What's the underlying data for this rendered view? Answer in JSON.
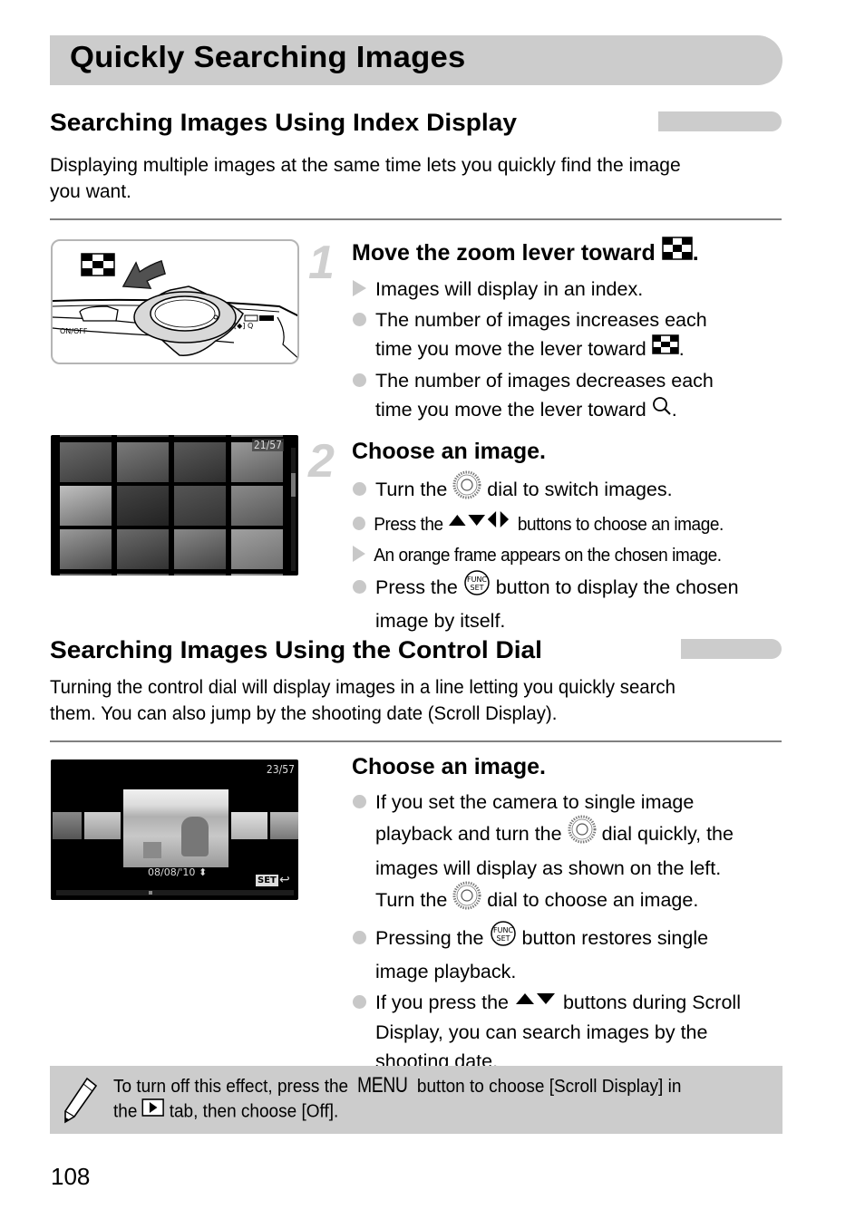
{
  "page": {
    "title": "Quickly Searching Images",
    "page_number": "108"
  },
  "section1": {
    "heading": "Searching Images Using Index Display",
    "intro_lines": [
      "Displaying multiple images at the same time lets you quickly find the image",
      "you want."
    ],
    "figure1": {
      "label": "ON/OFF",
      "icon": "index-checker-icon"
    },
    "step1": {
      "number": "1",
      "title": "Move the zoom lever toward",
      "title_icon": "index-checker-icon",
      "title_end": ".",
      "bullets": [
        {
          "type": "result",
          "lines": [
            "Images will display in an index."
          ]
        },
        {
          "type": "info",
          "lines": [
            "The number of images increases each",
            "time you move the lever toward"
          ],
          "icon": "index-checker-icon",
          "end": "."
        },
        {
          "type": "info",
          "lines": [
            "The number of images decreases each",
            "time you move the lever toward"
          ],
          "icon": "magnifier-icon",
          "end": "."
        }
      ]
    },
    "figure2": {
      "counter": "21/57"
    },
    "step2": {
      "number": "2",
      "title": "Choose an image.",
      "bullets": [
        {
          "type": "info",
          "before": "Turn the",
          "icon": "control-dial-icon",
          "after": "dial to switch images."
        },
        {
          "type": "info",
          "before": "Press the",
          "icon": "arrow-buttons-icon",
          "after": "buttons to choose an image."
        },
        {
          "type": "result",
          "text": "An orange frame appears on the chosen image."
        },
        {
          "type": "info",
          "before": "Press the",
          "icon": "func-set-icon",
          "after": "button to display the chosen",
          "line2": "image by itself."
        }
      ]
    }
  },
  "section2": {
    "heading": "Searching Images Using the Control Dial",
    "intro_lines": [
      "Turning the control dial will display images in a line letting you quickly search",
      "them. You can also jump by the shooting date (Scroll Display)."
    ],
    "figure3": {
      "counter": "23/57",
      "date": "08/08/'10",
      "set_label": "SET"
    },
    "step": {
      "title": "Choose an image.",
      "bullets": [
        {
          "lines": [
            "If you set the camera to single image",
            "playback and turn the",
            "dial quickly, the",
            "images will display as shown on the left.",
            "Turn the",
            "dial to choose an image."
          ]
        },
        {
          "lines": [
            "Pressing the",
            "button restores single",
            "image playback."
          ]
        },
        {
          "lines": [
            "If you press the",
            "buttons during Scroll",
            "Display, you can search images by the",
            "shooting date."
          ]
        }
      ]
    }
  },
  "note": {
    "icon": "pencil-icon",
    "part1": "To turn off this effect, press the",
    "menu_word": "MENU",
    "part2": "button to choose [Scroll Display] in",
    "part3": "the",
    "tab_icon": "playback-tab-icon",
    "part4": "tab, then choose [Off]."
  },
  "colors": {
    "accent_gray": "#cccccc",
    "bullet_gray": "#c8c8c8",
    "step_number_gray": "#cfcfcf",
    "rule_gray": "#808080"
  }
}
